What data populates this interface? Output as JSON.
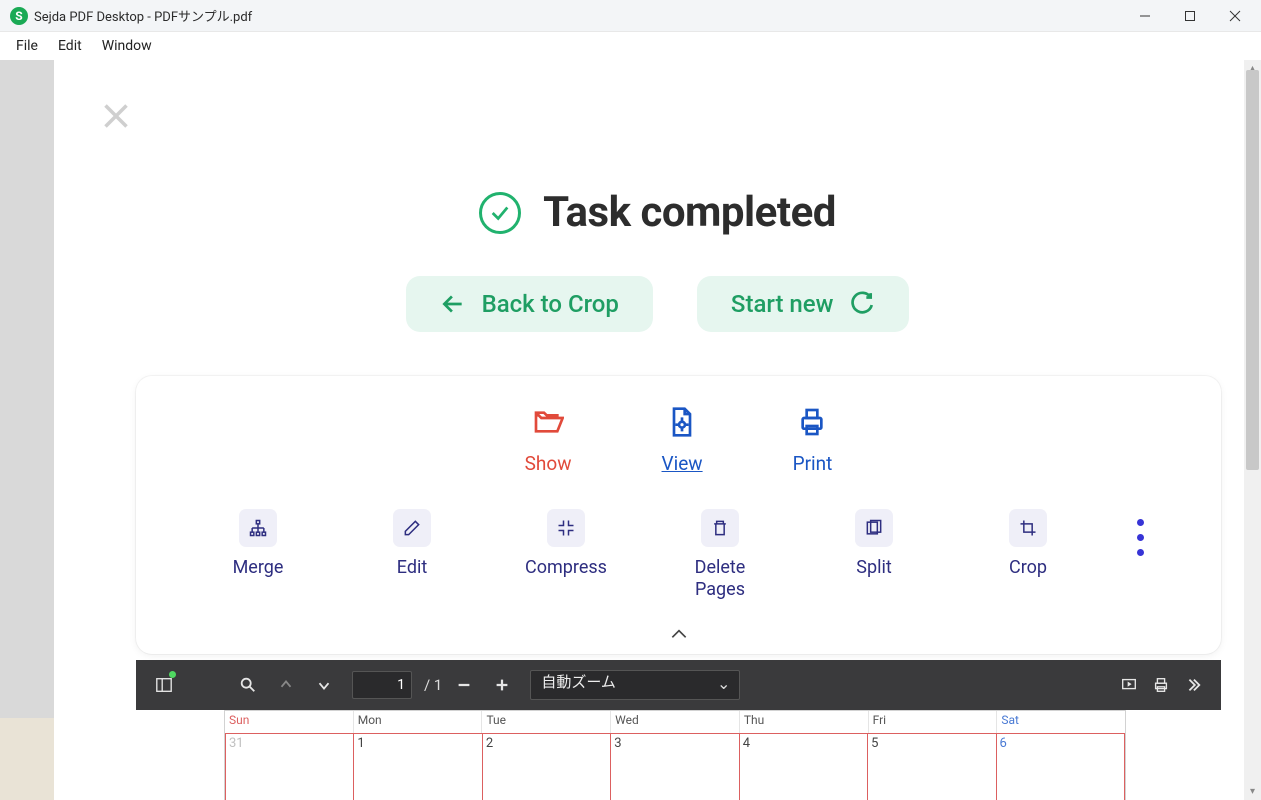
{
  "window": {
    "title": "Sejda PDF Desktop - PDFサンプル.pdf",
    "app_initial": "S"
  },
  "menubar": {
    "file": "File",
    "edit": "Edit",
    "window": "Window"
  },
  "task": {
    "heading": "Task completed",
    "back_label": "Back to Crop",
    "start_label": "Start new"
  },
  "primary_tools": {
    "show": "Show",
    "view": "View",
    "print": "Print"
  },
  "secondary_tools": {
    "merge": "Merge",
    "edit": "Edit",
    "compress": "Compress",
    "delete_pages": "Delete Pages",
    "split": "Split",
    "crop": "Crop"
  },
  "pdf_toolbar": {
    "page_current": "1",
    "page_total": "/ 1",
    "zoom_label": "自動ズーム"
  },
  "calendar": {
    "headers": [
      "Sun",
      "Mon",
      "Tue",
      "Wed",
      "Thu",
      "Fri",
      "Sat"
    ],
    "row1": [
      "31",
      "1",
      "2",
      "3",
      "4",
      "5",
      "6"
    ]
  }
}
